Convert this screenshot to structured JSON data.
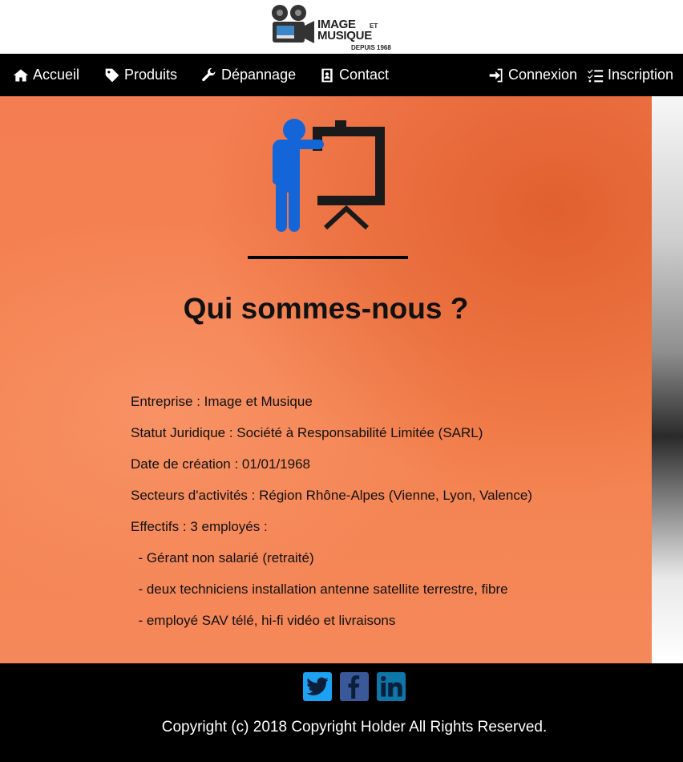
{
  "brand": {
    "line1": "IMAGE",
    "line2": "MUSIQUE",
    "et": "ET",
    "since": "DEPUIS 1968"
  },
  "nav": {
    "left": [
      {
        "label": "Accueil",
        "icon": "home-icon"
      },
      {
        "label": "Produits",
        "icon": "tag-icon"
      },
      {
        "label": "Dépannage",
        "icon": "wrench-icon"
      },
      {
        "label": "Contact",
        "icon": "contact-card-icon"
      }
    ],
    "right": [
      {
        "label": "Connexion",
        "icon": "sign-in-icon"
      },
      {
        "label": "Inscription",
        "icon": "checklist-icon"
      }
    ]
  },
  "hero": {
    "icon": "presenter-board-icon",
    "title": "Qui sommes-nous ?",
    "info": [
      "Entreprise : Image et Musique",
      "Statut Juridique : Société à Responsabilité Limitée (SARL)",
      "Date de création : 01/01/1968",
      "Secteurs d'activités : Région Rhône-Alpes (Vienne, Lyon, Valence)",
      "Effectifs : 3 employés :",
      "  - Gérant non salarié (retraité)",
      "  - deux techniciens installation antenne satellite terrestre, fibre",
      "  - employé SAV télé, hi-fi vidéo et livraisons"
    ]
  },
  "footer": {
    "socials": [
      {
        "name": "twitter-icon",
        "color": "#1da1f2"
      },
      {
        "name": "facebook-icon",
        "color": "#3b5998"
      },
      {
        "name": "linkedin-icon",
        "color": "#0e76a8"
      }
    ],
    "copyright": "Copyright (c) 2018 Copyright Holder All Rights Reserved."
  },
  "colors": {
    "overlay": "#f47e52",
    "nav_bg": "#000000",
    "presenter_blue": "#1466d8"
  }
}
